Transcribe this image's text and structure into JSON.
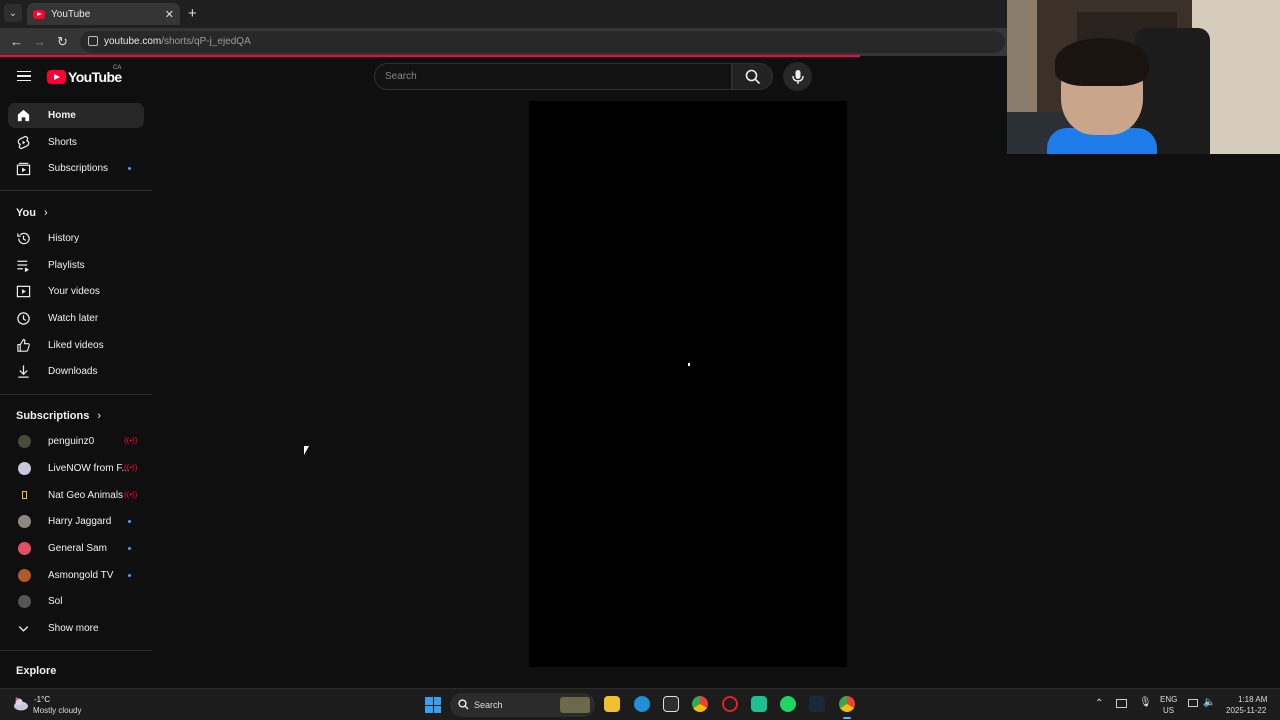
{
  "browser": {
    "tab_title": "YouTube",
    "tab_close": "✕",
    "new_tab": "+",
    "url_host": "youtube.com",
    "url_path": "/shorts/qP-j_ejedQA"
  },
  "header": {
    "logo_text": "YouTube",
    "country_code": "CA",
    "search_placeholder": "Search"
  },
  "sidebar": {
    "main": [
      {
        "label": "Home",
        "icon": "home-icon",
        "active": true
      },
      {
        "label": "Shorts",
        "icon": "shorts-icon"
      },
      {
        "label": "Subscriptions",
        "icon": "subscriptions-icon",
        "dot": true
      }
    ],
    "you_heading": "You",
    "you": [
      {
        "label": "History",
        "icon": "history-icon"
      },
      {
        "label": "Playlists",
        "icon": "playlists-icon"
      },
      {
        "label": "Your videos",
        "icon": "your-videos-icon"
      },
      {
        "label": "Watch later",
        "icon": "watch-later-icon"
      },
      {
        "label": "Liked videos",
        "icon": "like-icon"
      },
      {
        "label": "Downloads",
        "icon": "download-icon"
      }
    ],
    "subscriptions_heading": "Subscriptions",
    "subscriptions": [
      {
        "label": "penguinz0",
        "status": "live",
        "avatar_color": "#4a4a3a"
      },
      {
        "label": "LiveNOW from F...",
        "status": "live",
        "avatar_color": "#c8c8d8"
      },
      {
        "label": "Nat Geo Animals",
        "status": "live",
        "avatar_color": "#f0c020"
      },
      {
        "label": "Harry Jaggard",
        "status": "new",
        "avatar_color": "#8a8a80"
      },
      {
        "label": "General Sam",
        "status": "new",
        "avatar_color": "#e05060"
      },
      {
        "label": "Asmongold TV",
        "status": "new",
        "avatar_color": "#b05a2a"
      },
      {
        "label": "Sol",
        "status": "",
        "avatar_color": "#555555"
      }
    ],
    "show_more": "Show more",
    "explore_heading": "Explore"
  },
  "taskbar": {
    "weather_temp": "-1°C",
    "weather_desc": "Mostly cloudy",
    "search_label": "Search",
    "lang_top": "ENG",
    "lang_bottom": "US",
    "time": "1:18 AM",
    "date": "2025-11-22"
  },
  "colors": {
    "accent_red": "#ff0033",
    "accent_blue": "#3ea6ff",
    "background": "#0f0f0f"
  }
}
